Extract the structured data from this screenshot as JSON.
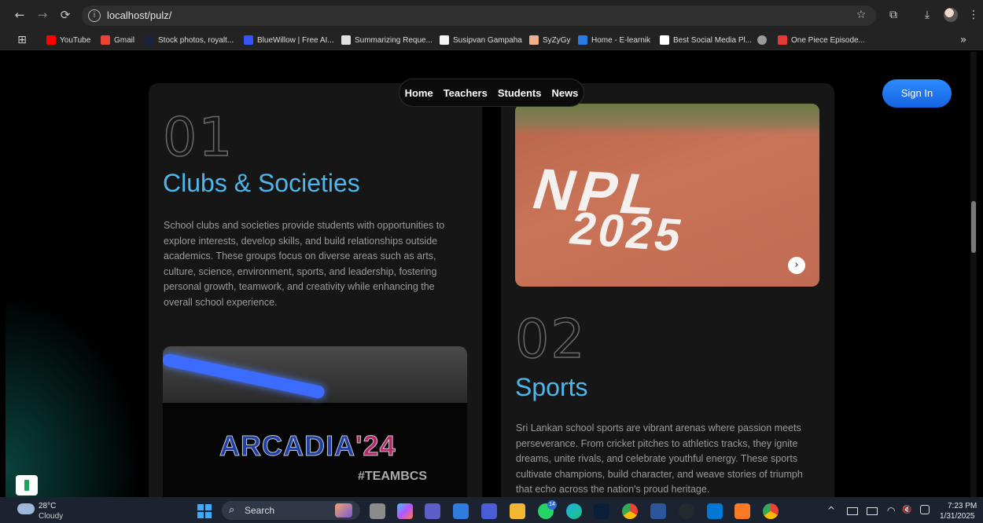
{
  "browser": {
    "url": "localhost/pulz/",
    "nav_icons": {
      "back": "←",
      "forward": "→",
      "reload": "⟳"
    },
    "info_icon": "i",
    "toolbar_icons": {
      "star": "☆",
      "extensions": "⧉",
      "download": "⤓",
      "menu": "⋮"
    },
    "bookmarks_apps_icon": "⊞",
    "bookmarks_more_icon": "»",
    "bookmarks": [
      {
        "label": "YouTube",
        "color": "#ff0000"
      },
      {
        "label": "Gmail",
        "color": "#ea4335"
      },
      {
        "label": "Stock photos, royalt...",
        "color": "#1b2240"
      },
      {
        "label": "BlueWillow | Free AI...",
        "color": "#3655ff"
      },
      {
        "label": "Summarizing Reque...",
        "color": "#e0e0e0"
      },
      {
        "label": "Susipvan Gampaha",
        "color": "#f5f5f5"
      },
      {
        "label": "SyZyGy",
        "color": "#f0b08a"
      },
      {
        "label": "Home - E-learnik",
        "color": "#2c7be5"
      },
      {
        "label": "Best Social Media Pl...",
        "color": "#ffffff"
      },
      {
        "label": "",
        "color": "#9a9a9a"
      },
      {
        "label": "One Piece Episode...",
        "color": "#e53935"
      }
    ]
  },
  "site": {
    "nav": [
      "Home",
      "Teachers",
      "Students",
      "News"
    ],
    "sign_in": "Sign In",
    "next_icon": "›",
    "sections": [
      {
        "number": "01",
        "title": "Clubs & Societies",
        "text": "School clubs and societies provide students with opportunities to explore interests, develop skills, and build relationships outside academics. These groups focus on diverse areas such as arts, culture, science, environment, sports, and leadership, fostering personal growth, teamwork, and creativity while enhancing the overall school experience."
      },
      {
        "number": "02",
        "title": "Sports",
        "text": "Sri Lankan school sports are vibrant arenas where passion meets perseverance. From cricket pitches to athletics tracks, they ignite dreams, unite rivals, and celebrate youthful energy. These sports cultivate champions, build character, and weave stories of triumph that echo across the nation's proud heritage."
      }
    ],
    "npl_image": {
      "line1": "NPL",
      "line2": "2025"
    },
    "arcadia_image": {
      "word": "ARCADIA",
      "year": "'24",
      "tag": "#TEAMBCS"
    }
  },
  "taskbar": {
    "weather_temp": "28°C",
    "weather_desc": "Cloudy",
    "search_icon": "⌕",
    "search_label": "Search",
    "whatsapp_badge": "14",
    "tray_icons": {
      "chevron": "^",
      "volume": "🔇",
      "wifi": "◠"
    },
    "time": "7:23 PM",
    "date": "1/31/2025"
  },
  "colors": {
    "accent": "#4eb6ea",
    "button": "#2e8bff",
    "card": "#161616"
  }
}
